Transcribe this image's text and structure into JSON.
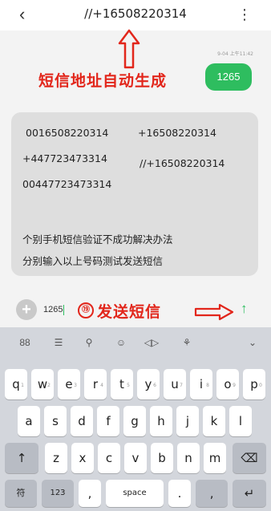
{
  "header": {
    "back_icon": "‹",
    "title": "//+16508220314",
    "more_icon": "⋮"
  },
  "annotations": {
    "title": "短信地址自动生成",
    "step_number": "⑲",
    "send_label": "发送短信",
    "color": "#e2261b"
  },
  "thread": {
    "timestamp": "9-04 上午11:42",
    "sent_message": "1265",
    "received_numbers": [
      "0016508220314",
      "+16508220314",
      "+447723473314",
      "//+16508220314",
      "00447723473314"
    ],
    "received_tip_line1": "个别手机短信验证不成功解决办法",
    "received_tip_line2": "分别输入以上号码测试发送短信"
  },
  "composer": {
    "add_icon": "+",
    "input_value": "1265",
    "send_icon": "↑",
    "accent": "#2ebd5f"
  },
  "keyboard": {
    "toolbar": [
      "88",
      "☰",
      "⚲",
      "☺",
      "◁▷",
      "⚘",
      "⌄"
    ],
    "row1": [
      "q",
      "w",
      "e",
      "r",
      "t",
      "y",
      "u",
      "i",
      "o",
      "p"
    ],
    "row1_hints": [
      "1",
      "2",
      "3",
      "4",
      "5",
      "6",
      "7",
      "8",
      "9",
      "0"
    ],
    "row2": [
      "a",
      "s",
      "d",
      "f",
      "g",
      "h",
      "j",
      "k",
      "l"
    ],
    "row3": [
      "z",
      "x",
      "c",
      "v",
      "b",
      "n",
      "m"
    ],
    "shift": "↑",
    "backspace": "⌫",
    "symbols": "符",
    "numbers": "123",
    "comma": ",",
    "space": "space",
    "period": ".",
    "emoji_key": "‚",
    "enter": "↵"
  }
}
